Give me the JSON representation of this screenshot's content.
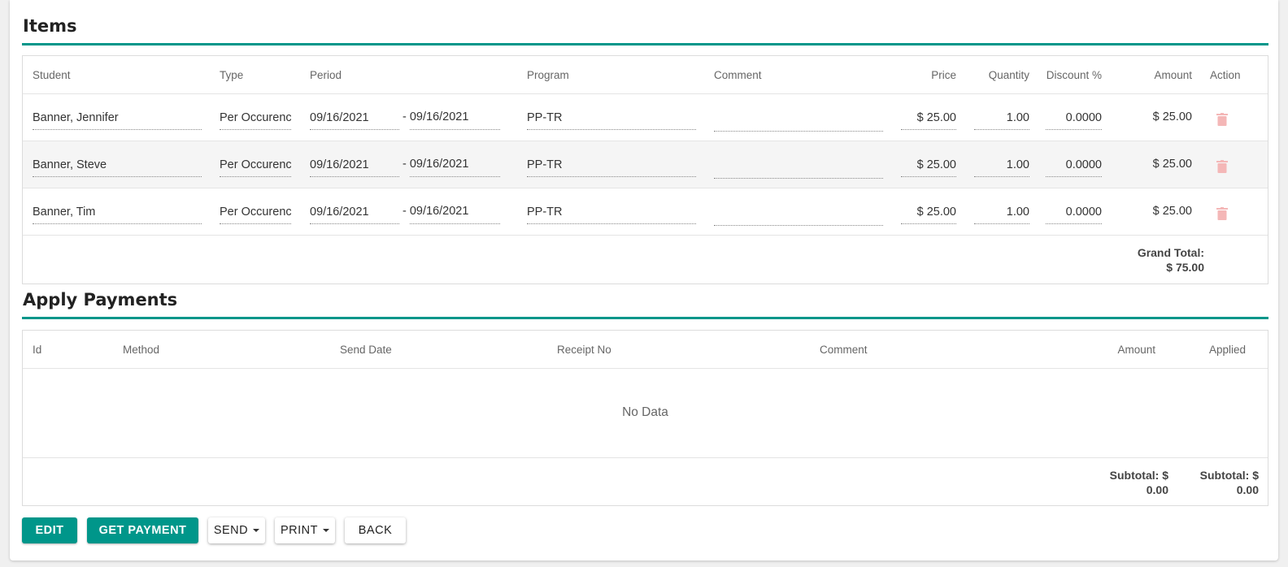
{
  "items": {
    "title": "Items",
    "headers": {
      "student": "Student",
      "type": "Type",
      "period": "Period",
      "program": "Program",
      "comment": "Comment",
      "price": "Price",
      "quantity": "Quantity",
      "discount": "Discount %",
      "amount": "Amount",
      "action": "Action"
    },
    "rows": [
      {
        "student": "Banner, Jennifer",
        "type": "Per Occurence",
        "period_start": "09/16/2021",
        "period_end": "- 09/16/2021",
        "program": "PP-TR",
        "comment": "",
        "price": "$ 25.00",
        "quantity": "1.00",
        "discount": "0.0000",
        "amount": "$ 25.00"
      },
      {
        "student": "Banner, Steve",
        "type": "Per Occurence",
        "period_start": "09/16/2021",
        "period_end": "- 09/16/2021",
        "program": "PP-TR",
        "comment": "",
        "price": "$ 25.00",
        "quantity": "1.00",
        "discount": "0.0000",
        "amount": "$ 25.00"
      },
      {
        "student": "Banner, Tim",
        "type": "Per Occurence",
        "period_start": "09/16/2021",
        "period_end": "- 09/16/2021",
        "program": "PP-TR",
        "comment": "",
        "price": "$ 25.00",
        "quantity": "1.00",
        "discount": "0.0000",
        "amount": "$ 25.00"
      }
    ],
    "grand_total_label": "Grand Total:",
    "grand_total_value": "$ 75.00"
  },
  "payments": {
    "title": "Apply Payments",
    "headers": {
      "id": "Id",
      "method": "Method",
      "send_date": "Send Date",
      "receipt_no": "Receipt No",
      "comment": "Comment",
      "amount": "Amount",
      "applied": "Applied"
    },
    "empty_text": "No Data",
    "subtotal_amount_label": "Subtotal: $",
    "subtotal_amount_value": "0.00",
    "subtotal_applied_label": "Subtotal: $",
    "subtotal_applied_value": "0.00"
  },
  "actions": {
    "edit": "EDIT",
    "get_payment": "GET PAYMENT",
    "send": "SEND",
    "print": "PRINT",
    "back": "BACK"
  },
  "colors": {
    "accent": "#00968a",
    "trash_icon": "#f4b7b7"
  },
  "icons": {
    "delete": "trash-icon",
    "dropdown": "caret-down-icon"
  }
}
